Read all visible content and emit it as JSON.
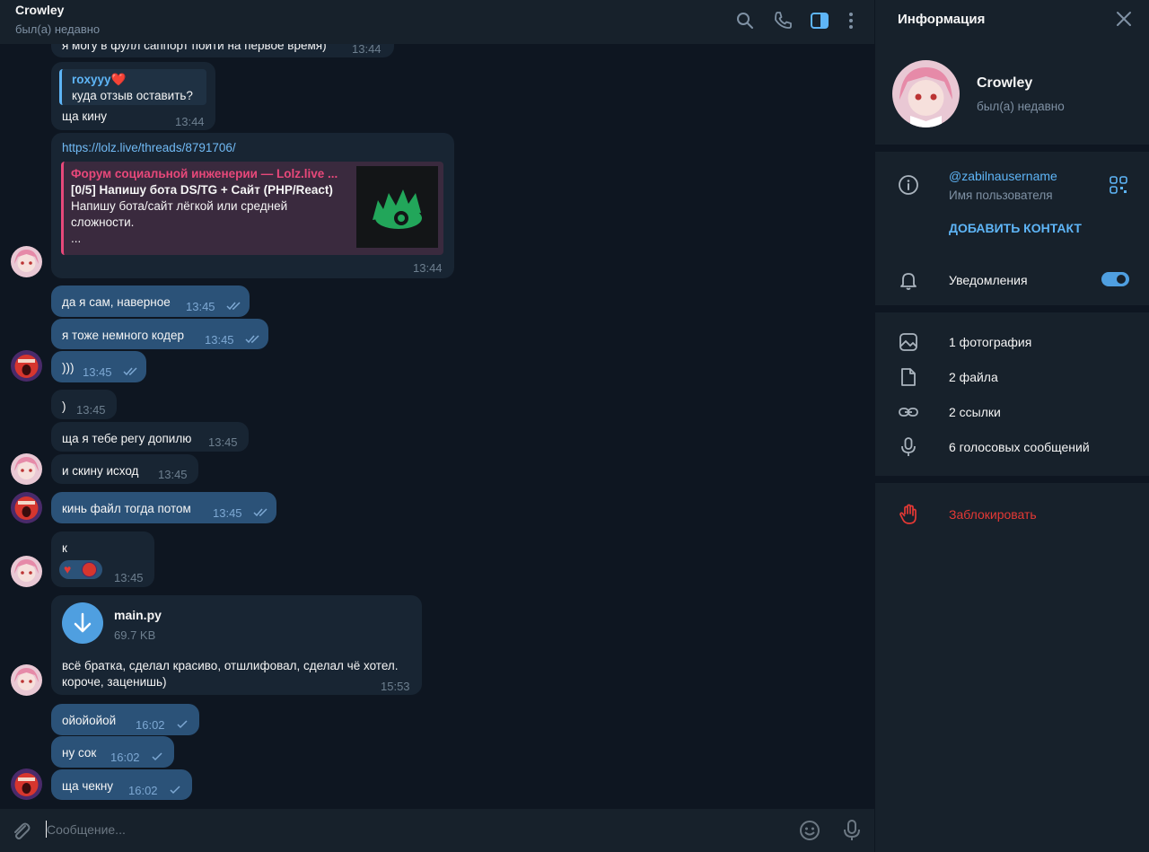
{
  "chat": {
    "header": {
      "title": "Crowley",
      "status": "был(а) недавно"
    },
    "messages": {
      "m0": {
        "text": "я могу в фулл саппорт пойти на первое время)",
        "time": "13:44"
      },
      "m1": {
        "reply_name": "roxyyy❤️",
        "reply_text": "куда отзыв оставить?",
        "text": "ща кину",
        "time": "13:44"
      },
      "m2": {
        "link": "https://lolz.live/threads/8791706/",
        "preview_site": "Форум социальной инженерии —  Lolz.live ...",
        "preview_title": "[0/5] Напишу бота DS/TG + Сайт (PHP/React)",
        "preview_desc_1": "Напишу бота/сайт лёгкой или средней",
        "preview_desc_2": "сложности.",
        "preview_desc_3": "...",
        "time": "13:44"
      },
      "m3": {
        "text": "да я сам, наверное",
        "time": "13:45"
      },
      "m4": {
        "text": "я тоже немного кодер",
        "time": "13:45"
      },
      "m5": {
        "text": ")))",
        "time": "13:45"
      },
      "m6": {
        "text": ")",
        "time": "13:45"
      },
      "m7": {
        "text": "ща я тебе регу допилю",
        "time": "13:45"
      },
      "m8": {
        "text": "и скину исход",
        "time": "13:45"
      },
      "m9": {
        "text": "кинь файл тогда потом",
        "time": "13:45"
      },
      "m10": {
        "text": "к",
        "time": "13:45"
      },
      "m11": {
        "file_name": "main.py",
        "file_size": "69.7 KB",
        "text_1": "всё братка, сделал красиво, отшлифовал, сделал чё хотел.",
        "text_2": "короче, заценишь)",
        "time": "15:53"
      },
      "m12": {
        "text": "ойойойой",
        "time": "16:02"
      },
      "m13": {
        "text": "ну сок",
        "time": "16:02"
      },
      "m14": {
        "text": "ща чекну",
        "time": "16:02"
      }
    },
    "composer": {
      "placeholder": "Сообщение..."
    }
  },
  "info": {
    "title": "Информация",
    "profile": {
      "name": "Crowley",
      "status": "был(а) недавно"
    },
    "username": {
      "value": "@zabilnausername",
      "label": "Имя пользователя"
    },
    "add_contact": "ДОБАВИТЬ КОНТАКТ",
    "notifications": {
      "label": "Уведомления",
      "enabled": true
    },
    "media": {
      "photos": "1 фотография",
      "files": "2 файла",
      "links": "2 ссылки",
      "voice": "6 голосовых сообщений"
    },
    "block": "Заблокировать"
  },
  "colors": {
    "background": "#0e1621",
    "panel": "#17212b",
    "incoming_bubble": "#182533",
    "outgoing_bubble": "#2b5278",
    "accent": "#5eb5f7",
    "danger": "#e53935",
    "preview_accent": "#e8487a"
  },
  "icons": {
    "header": [
      "search-icon",
      "phone-icon",
      "sidebar-toggle-icon",
      "more-vertical-icon"
    ],
    "composer": [
      "attach-icon",
      "emoji-icon",
      "microphone-icon"
    ],
    "info": [
      "close-icon",
      "info-icon",
      "qr-code-icon",
      "bell-icon",
      "photo-icon",
      "file-icon",
      "link-icon",
      "microphone-icon",
      "hand-block-icon"
    ]
  }
}
